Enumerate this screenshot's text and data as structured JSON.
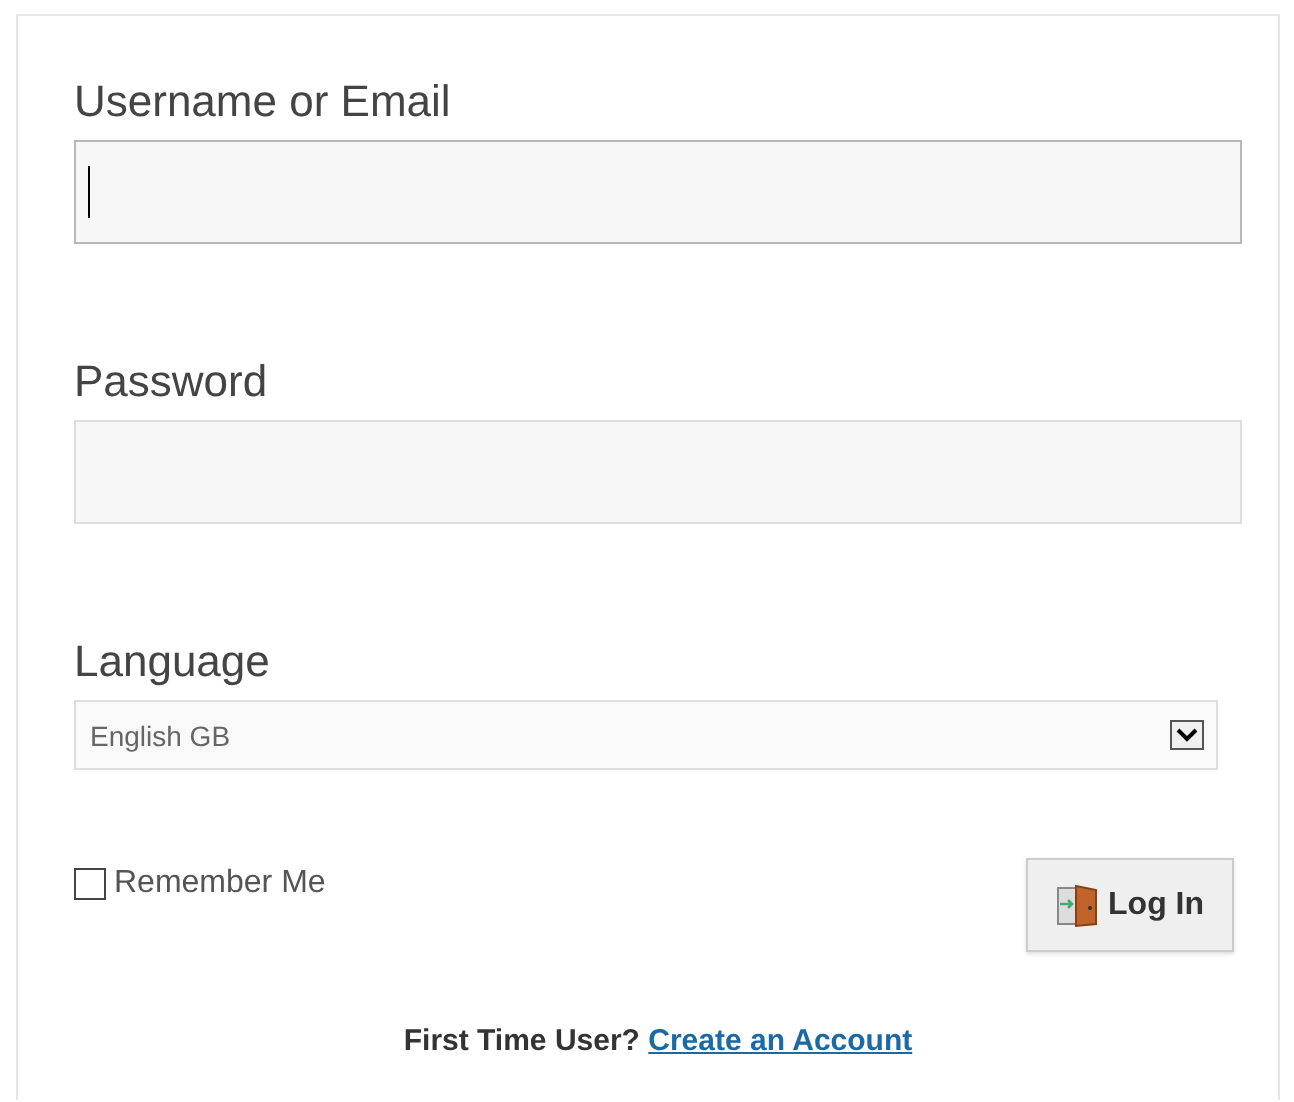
{
  "fields": [
    {
      "label": "Username or Email",
      "focused": true
    },
    {
      "label": "Password",
      "focused": false
    }
  ],
  "language": {
    "label": "Language",
    "value": "English GB"
  },
  "remember": {
    "label": "Remember Me",
    "checked": false
  },
  "login_button": {
    "label": "Log In"
  },
  "footer": {
    "text": "First Time User?",
    "link": "Create an Account"
  }
}
